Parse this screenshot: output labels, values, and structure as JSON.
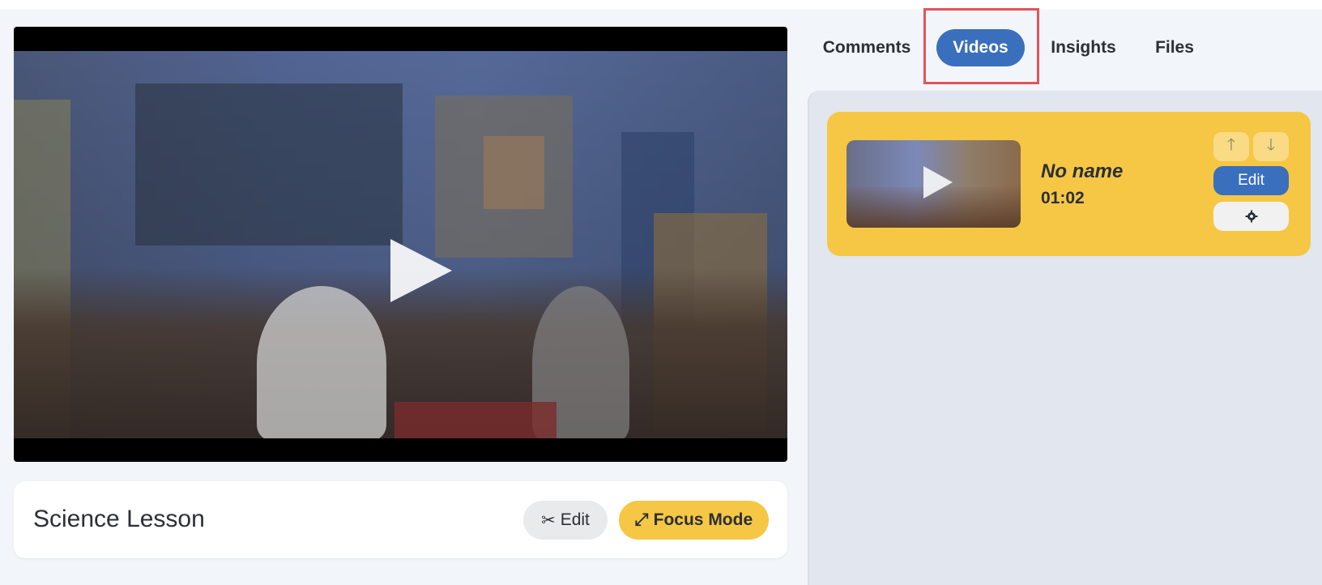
{
  "player": {
    "play_icon": "play-icon"
  },
  "lesson": {
    "title": "Science Lesson",
    "edit_label": "Edit",
    "edit_icon": "scissors-icon",
    "focus_label": "Focus Mode",
    "focus_icon": "expand-icon"
  },
  "tabs": [
    {
      "label": "Comments",
      "active": false
    },
    {
      "label": "Videos",
      "active": true
    },
    {
      "label": "Insights",
      "active": false
    },
    {
      "label": "Files",
      "active": false
    }
  ],
  "videos": [
    {
      "name": "No name",
      "duration": "01:02",
      "edit_label": "Edit",
      "settings_icon": "gear-icon",
      "move_up_icon": "arrow-up-icon",
      "move_down_icon": "arrow-down-icon"
    }
  ],
  "colors": {
    "accent_blue": "#3a6fbd",
    "accent_yellow": "#f6c744",
    "highlight_red": "#e2545b"
  }
}
